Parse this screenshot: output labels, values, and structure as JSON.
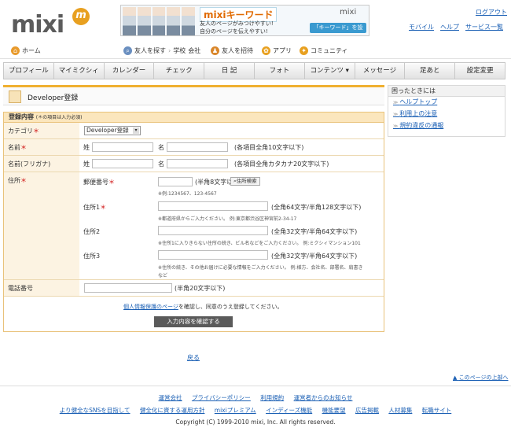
{
  "logo": {
    "text": "mixi",
    "badge": "m"
  },
  "banner": {
    "keyword": "mixiキーワード",
    "line1": "友人のページがみつけやすい!",
    "line2": "自分のページを伝えやすい!",
    "brand": "mixi",
    "button": "「キーワード」を設定!"
  },
  "header": {
    "logout": "ログアウト",
    "links": [
      "モバイル",
      "ヘルプ",
      "サービス一覧"
    ]
  },
  "subnav": {
    "home": "ホーム",
    "find_friends": "友人を探す",
    "school": "学校",
    "company": "会社",
    "invite": "友人を招待",
    "apps": "アプリ",
    "community": "コミュニティ"
  },
  "mainnav": [
    "プロフィール",
    "マイミクシィ",
    "カレンダー",
    "チェック",
    "日 記",
    "フォト",
    "コンテンツ ▾",
    "メッセージ",
    "足あと",
    "設定変更"
  ],
  "page": {
    "title": "Developer登録"
  },
  "form": {
    "header": "登録内容",
    "header_note": "(＊の項目は入力必須)",
    "category": {
      "label": "カテゴリ",
      "req": "＊",
      "value": "Developer登録"
    },
    "name": {
      "label": "名前",
      "req": "＊",
      "sei": "姓",
      "mei": "名",
      "hint": "(各項目全角10文字以下)"
    },
    "kana": {
      "label": "名前(フリガナ)",
      "sei": "姓",
      "mei": "名",
      "hint": "(各項目全角カタカナ20文字以下)"
    },
    "address": {
      "label": "住所",
      "req": "＊",
      "zip_label": "郵便番号",
      "zip_hint": "(半角8文字以下)",
      "search": "住所検索",
      "zip_note": "※例:1234567、123-4567",
      "a1_label": "住所1",
      "a1_hint": "(全角64文字/半角128文字以下)",
      "a1_note": "※都道府県からご入力ください。 例:東京都渋谷区神宮前2-34-17",
      "a2_label": "住所2",
      "a2_hint": "(全角32文字/半角64文字以下)",
      "a2_note": "※住所1に入りきらない住所の続き、ビル名などをご入力ください。 例:ミクシィマンション101",
      "a3_label": "住所3",
      "a3_hint": "(全角32文字/半角64文字以下)",
      "a3_note1": "※住所の続き、その他お届けに必要な情報をご入力ください。 例:様方、会社名、部署名、肩書き",
      "a3_note2": "など"
    },
    "phone": {
      "label": "電話番号",
      "hint": "(半角20文字以下)"
    },
    "privacy_link": "個人情報保護のページ",
    "privacy_text": "を確認し、同意のうえ登録してください。",
    "confirm": "入力内容を確認する"
  },
  "back": "戻る",
  "pagetop": "このページの上部へ",
  "side": {
    "header": "困ったときには",
    "links": [
      "ヘルプトップ",
      "利用上の注意",
      "規約違反の通報"
    ]
  },
  "footer": {
    "row1": [
      "運営会社",
      "プライバシーポリシー",
      "利用規約",
      "運営者からのお知らせ"
    ],
    "row2": [
      "より健全なSNSを目指して",
      "健全化に資する運用方針",
      "mixiプレミアム",
      "インディーズ機能",
      "機能要望",
      "広告掲載",
      "人材募集",
      "転職サイト"
    ],
    "copyright": "Copyright (C) 1999-2010 mixi, Inc. All rights reserved."
  }
}
